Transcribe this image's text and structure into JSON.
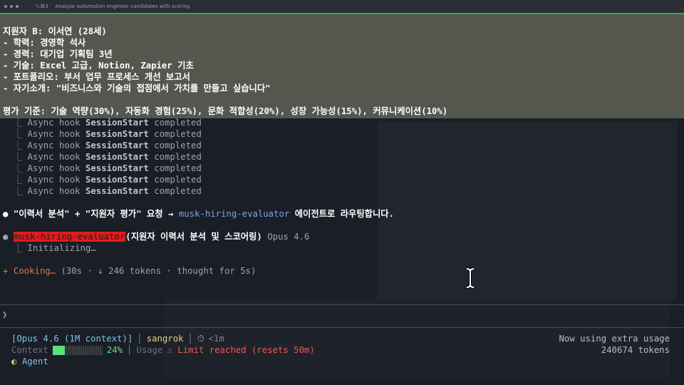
{
  "window": {
    "tab_key": "⌥⌘3",
    "title": "Analyze automation engineer candidates with scoring"
  },
  "candidate": {
    "header": "지원자 B: 이서연 (28세)",
    "details": [
      "- 학력: 경영학 석사",
      "- 경력: 대기업 기획팀 3년",
      "- 기술: Excel 고급, Notion, Zapier 기초",
      "- 포트폴리오: 부서 업무 프로세스 개선 보고서",
      "- 자기소개: \"비즈니스와 기술의 접점에서 가치를 만들고 싶습니다\""
    ],
    "criteria": "평가 기준: 기술 역량(30%), 자동화 경험(25%), 문화 적합성(20%), 성장 가능성(15%), 커뮤니케이션(10%)"
  },
  "hooks": {
    "branch": "⎿",
    "prefix": "Async hook",
    "event": "SessionStart",
    "status": "completed",
    "count_shown": 7
  },
  "routing": {
    "bullet": "●",
    "prefix": "\"이력서 분석\" + \"지원자 평가\" 요청 →",
    "agent": "musk-hiring-evaluator",
    "suffix": "에이전트로 라우팅합니다."
  },
  "subagent": {
    "bullet": "●",
    "name": "musk-hiring-evaluator",
    "task": "(지원자 이력서 분석 및 스코어링)",
    "model": "Opus 4.6",
    "status_branch": "⎿",
    "status": "Initializing…"
  },
  "cooking": {
    "star": "+",
    "word": "Cooking…",
    "meta": "(30s · ↓ 246 tokens · thought for 5s)"
  },
  "prompt_symbol": "❯",
  "status_bar": {
    "model": "[Opus 4.6 (1M context)]",
    "user": "sangrok",
    "clock_icon": "⏱",
    "since": "<1m",
    "context_label": "Context",
    "context_percent": "24%",
    "context_fraction": 0.24,
    "usage_label": "Usage",
    "warn_icon": "⚠",
    "limit_text": "Limit reached (resets 50m)",
    "mode_icon": "◐",
    "mode": "Agent",
    "right_line1": "Now using extra usage",
    "right_line2": "240674 tokens"
  },
  "colors": {
    "accent_green": "#2fa84f",
    "agent_blue": "#7ea4e8",
    "highlight_red": "#e01c1c",
    "cooking_orange": "#e8704a",
    "context_green": "#5de07a",
    "limit_red": "#e85a5a"
  }
}
